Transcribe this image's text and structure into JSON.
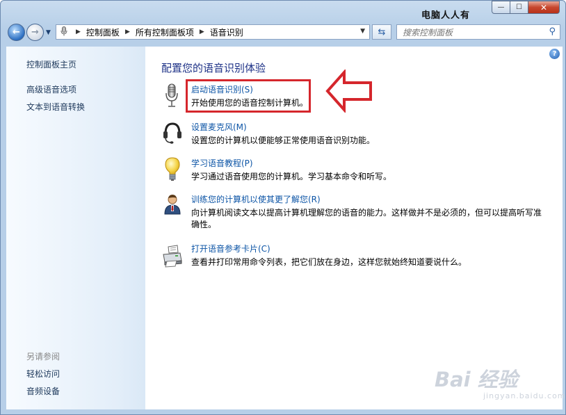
{
  "window": {
    "title_text": "电脑人人有",
    "min_glyph": "—",
    "max_glyph": "☐",
    "close_glyph": "✕"
  },
  "nav": {
    "back_glyph": "←",
    "forward_glyph": "→",
    "history_drop": "▼",
    "breadcrumbs": [
      "控制面板",
      "所有控制面板项",
      "语音识别"
    ],
    "crumb_separator": "▶",
    "address_drop": "▼",
    "refresh_glyph": "⇆",
    "search_placeholder": "搜索控制面板",
    "search_icon": "⚲"
  },
  "sidebar": {
    "home": "控制面板主页",
    "links": [
      "高级语音选项",
      "文本到语音转换"
    ],
    "see_also_header": "另请参阅",
    "see_also": [
      "轻松访问",
      "音频设备"
    ]
  },
  "main": {
    "help_glyph": "?",
    "heading": "配置您的语音识别体验",
    "items": [
      {
        "icon": "microphone-icon",
        "link": "启动语音识别(S)",
        "desc": "开始使用您的语音控制计算机。"
      },
      {
        "icon": "headset-icon",
        "link": "设置麦克风(M)",
        "desc": "设置您的计算机以便能够正常使用语音识别功能。"
      },
      {
        "icon": "lightbulb-icon",
        "link": "学习语音教程(P)",
        "desc": "学习通过语音使用您的计算机。学习基本命令和听写。"
      },
      {
        "icon": "user-icon",
        "link": "训练您的计算机以使其更了解您(R)",
        "desc": "向计算机阅读文本以提高计算机理解您的语音的能力。这样做并不是必须的，但可以提高听写准确性。"
      },
      {
        "icon": "printer-icon",
        "link": "打开语音参考卡片(C)",
        "desc": "查看并打印常用命令列表，把它们放在身边，这样您就始终知道要说什么。"
      }
    ]
  },
  "watermark": {
    "main": "Bai 经验",
    "sub": "jingyan.baidu.com"
  },
  "colors": {
    "link": "#0d55a6",
    "heading": "#1e3287",
    "annotation_red": "#d5262c"
  }
}
